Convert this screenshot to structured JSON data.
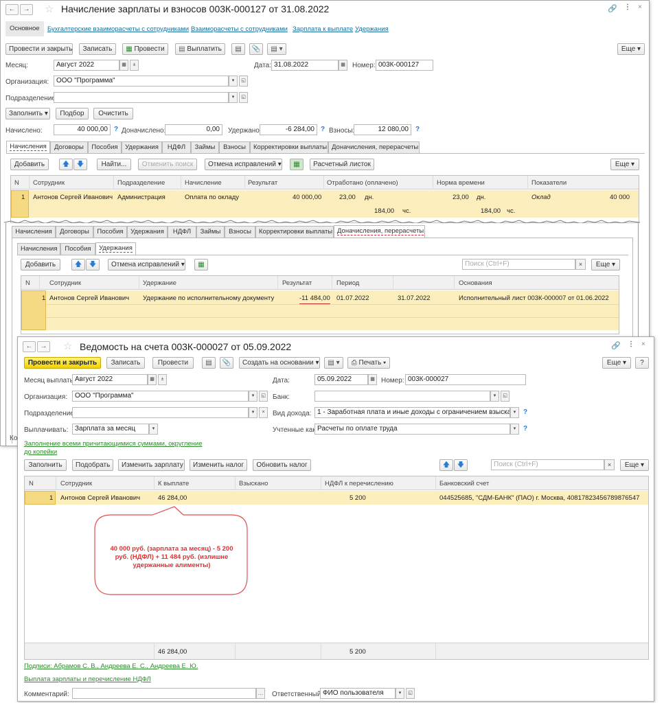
{
  "w1": {
    "title": "Начисление зарплаты и взносов 003К-000127 от 31.08.2022",
    "nav_tabs": [
      "Основное",
      "Бухгалтерские взаиморасчеты с сотрудниками",
      "Взаиморасчеты с сотрудниками",
      "Зарплата к выплате",
      "Удержания"
    ],
    "toolbar": {
      "post_close": "Провести и закрыть",
      "save": "Записать",
      "post": "Провести",
      "pay": "Выплатить",
      "more": "Еще"
    },
    "month_label": "Месяц:",
    "month_value": "Август 2022",
    "date_label": "Дата:",
    "date_value": "31.08.2022",
    "number_label": "Номер:",
    "number_value": "003К-000127",
    "org_label": "Организация:",
    "org_value": "ООО \"Программа\"",
    "dept_label": "Подразделение:",
    "dept_value": "",
    "fill": "Заполнить",
    "select": "Подбор",
    "clear": "Очистить",
    "accrued_label": "Начислено:",
    "accrued": "40 000,00",
    "extra_label": "Доначислено:",
    "extra": "0,00",
    "withheld_label": "Удержано:",
    "withheld": "-6 284,00",
    "contrib_label": "Взносы:",
    "contrib": "12 080,00",
    "doc_tabs": [
      "Начисления",
      "Договоры",
      "Пособия",
      "Удержания",
      "НДФЛ",
      "Займы",
      "Взносы",
      "Корректировки выплаты",
      "Доначисления, перерасчеты"
    ],
    "grid_toolbar": {
      "add": "Добавить",
      "find": "Найти...",
      "cancel_search": "Отменить поиск",
      "cancel_fix": "Отмена исправлений",
      "payslip": "Расчетный листок",
      "more": "Еще"
    },
    "columns": [
      "N",
      "Сотрудник",
      "Подразделение",
      "Начисление",
      "Результат",
      "Отработано (оплачено)",
      "Норма времени",
      "Показатели"
    ],
    "row": {
      "n": "1",
      "employee": "Антонов Сергей Иванович",
      "dept": "Администрация",
      "accrual": "Оплата по окладу",
      "result": "40 000,00",
      "worked_days": "23,00",
      "days_unit": "дн.",
      "worked_hours": "184,00",
      "hours_unit": "чс.",
      "norm_days": "23,00",
      "norm_hours": "184,00",
      "indicator": "Оклад",
      "indicator_value": "40 000"
    }
  },
  "w2": {
    "doc_tabs": [
      "Начисления",
      "Договоры",
      "Пособия",
      "Удержания",
      "НДФЛ",
      "Займы",
      "Взносы",
      "Корректировки выплаты",
      "Доначисления, перерасчеты"
    ],
    "sub_tabs": [
      "Начисления",
      "Пособия",
      "Удержания"
    ],
    "add": "Добавить",
    "cancel_fix": "Отмена исправлений",
    "search_placeholder": "Поиск (Ctrl+F)",
    "more": "Еще",
    "columns": [
      "N",
      "Сотрудник",
      "Удержание",
      "Результат",
      "Период",
      "Основания"
    ],
    "row": {
      "n": "1",
      "employee": "Антонов Сергей Иванович",
      "deduction": "Удержание по исполнительному документу",
      "result": "-11 484,00",
      "period_from": "01.07.2022",
      "period_to": "31.07.2022",
      "basis": "Исполнительный лист 003К-000007 от 01.06.2022"
    },
    "partial_label": "Ко"
  },
  "w3": {
    "title": "Ведомость на счета 003К-000027 от 05.09.2022",
    "toolbar": {
      "post_close": "Провести и закрыть",
      "save": "Записать",
      "post": "Провести",
      "create_based": "Создать на основании",
      "print": "Печать",
      "more": "Еще",
      "help": "?"
    },
    "month_label": "Месяц выплаты:",
    "month_value": "Август 2022",
    "date_label": "Дата:",
    "date_value": "05.09.2022",
    "number_label": "Номер:",
    "number_value": "003К-000027",
    "org_label": "Организация:",
    "org_value": "ООО \"Программа\"",
    "bank_label": "Банк:",
    "bank_value": "",
    "dept_label": "Подразделение:",
    "dept_value": "",
    "income_label": "Вид дохода:",
    "income_value": "1 - Заработная плата и иные доходы с ограничением взыскания",
    "pay_label": "Выплачивать:",
    "pay_value": "Зарплата за месяц",
    "counted_label": "Учтенные как:",
    "counted_value": "Расчеты по оплате труда",
    "fill_link": "Заполнение всеми причитающимися суммами, округление до копейки",
    "grid_toolbar": {
      "fill": "Заполнить",
      "select": "Подобрать",
      "change_salary": "Изменить зарплату",
      "change_tax": "Изменить налог",
      "update_tax": "Обновить налог",
      "search_placeholder": "Поиск (Ctrl+F)",
      "more": "Еще"
    },
    "columns": [
      "N",
      "Сотрудник",
      "К выплате",
      "Взыскано",
      "НДФЛ к перечислению",
      "Банковский счет"
    ],
    "row": {
      "n": "1",
      "employee": "Антонов Сергей Иванович",
      "to_pay": "46 284,00",
      "collected": "",
      "ndfl": "5 200",
      "account": "044525685, \"СДМ-БАНК\" (ПАО) г. Москва, 40817823456789876547"
    },
    "totals": {
      "to_pay": "46 284,00",
      "ndfl": "5 200"
    },
    "callout": "40 000 руб. (зарплата за месяц) - 5 200 руб. (НДФЛ) + 11 484 руб. (излишне удержанные алименты)",
    "signatures_link": "Подписи: Абрамов С. В., Андреева Е. С., Андреева Е. Ю.",
    "ndfl_link": "Выплата зарплаты и перечисление НДФЛ",
    "comment_label": "Комментарий:",
    "responsible_label": "Ответственный:",
    "responsible_value": "ФИО пользователя"
  },
  "colors": {
    "row_highlight": "#fcefbd",
    "link": "#1a6f9c",
    "green_link": "#2c8a2c",
    "callout_border": "#e05050",
    "callout_text": "#e03030",
    "primary_button": "#f2d200"
  }
}
